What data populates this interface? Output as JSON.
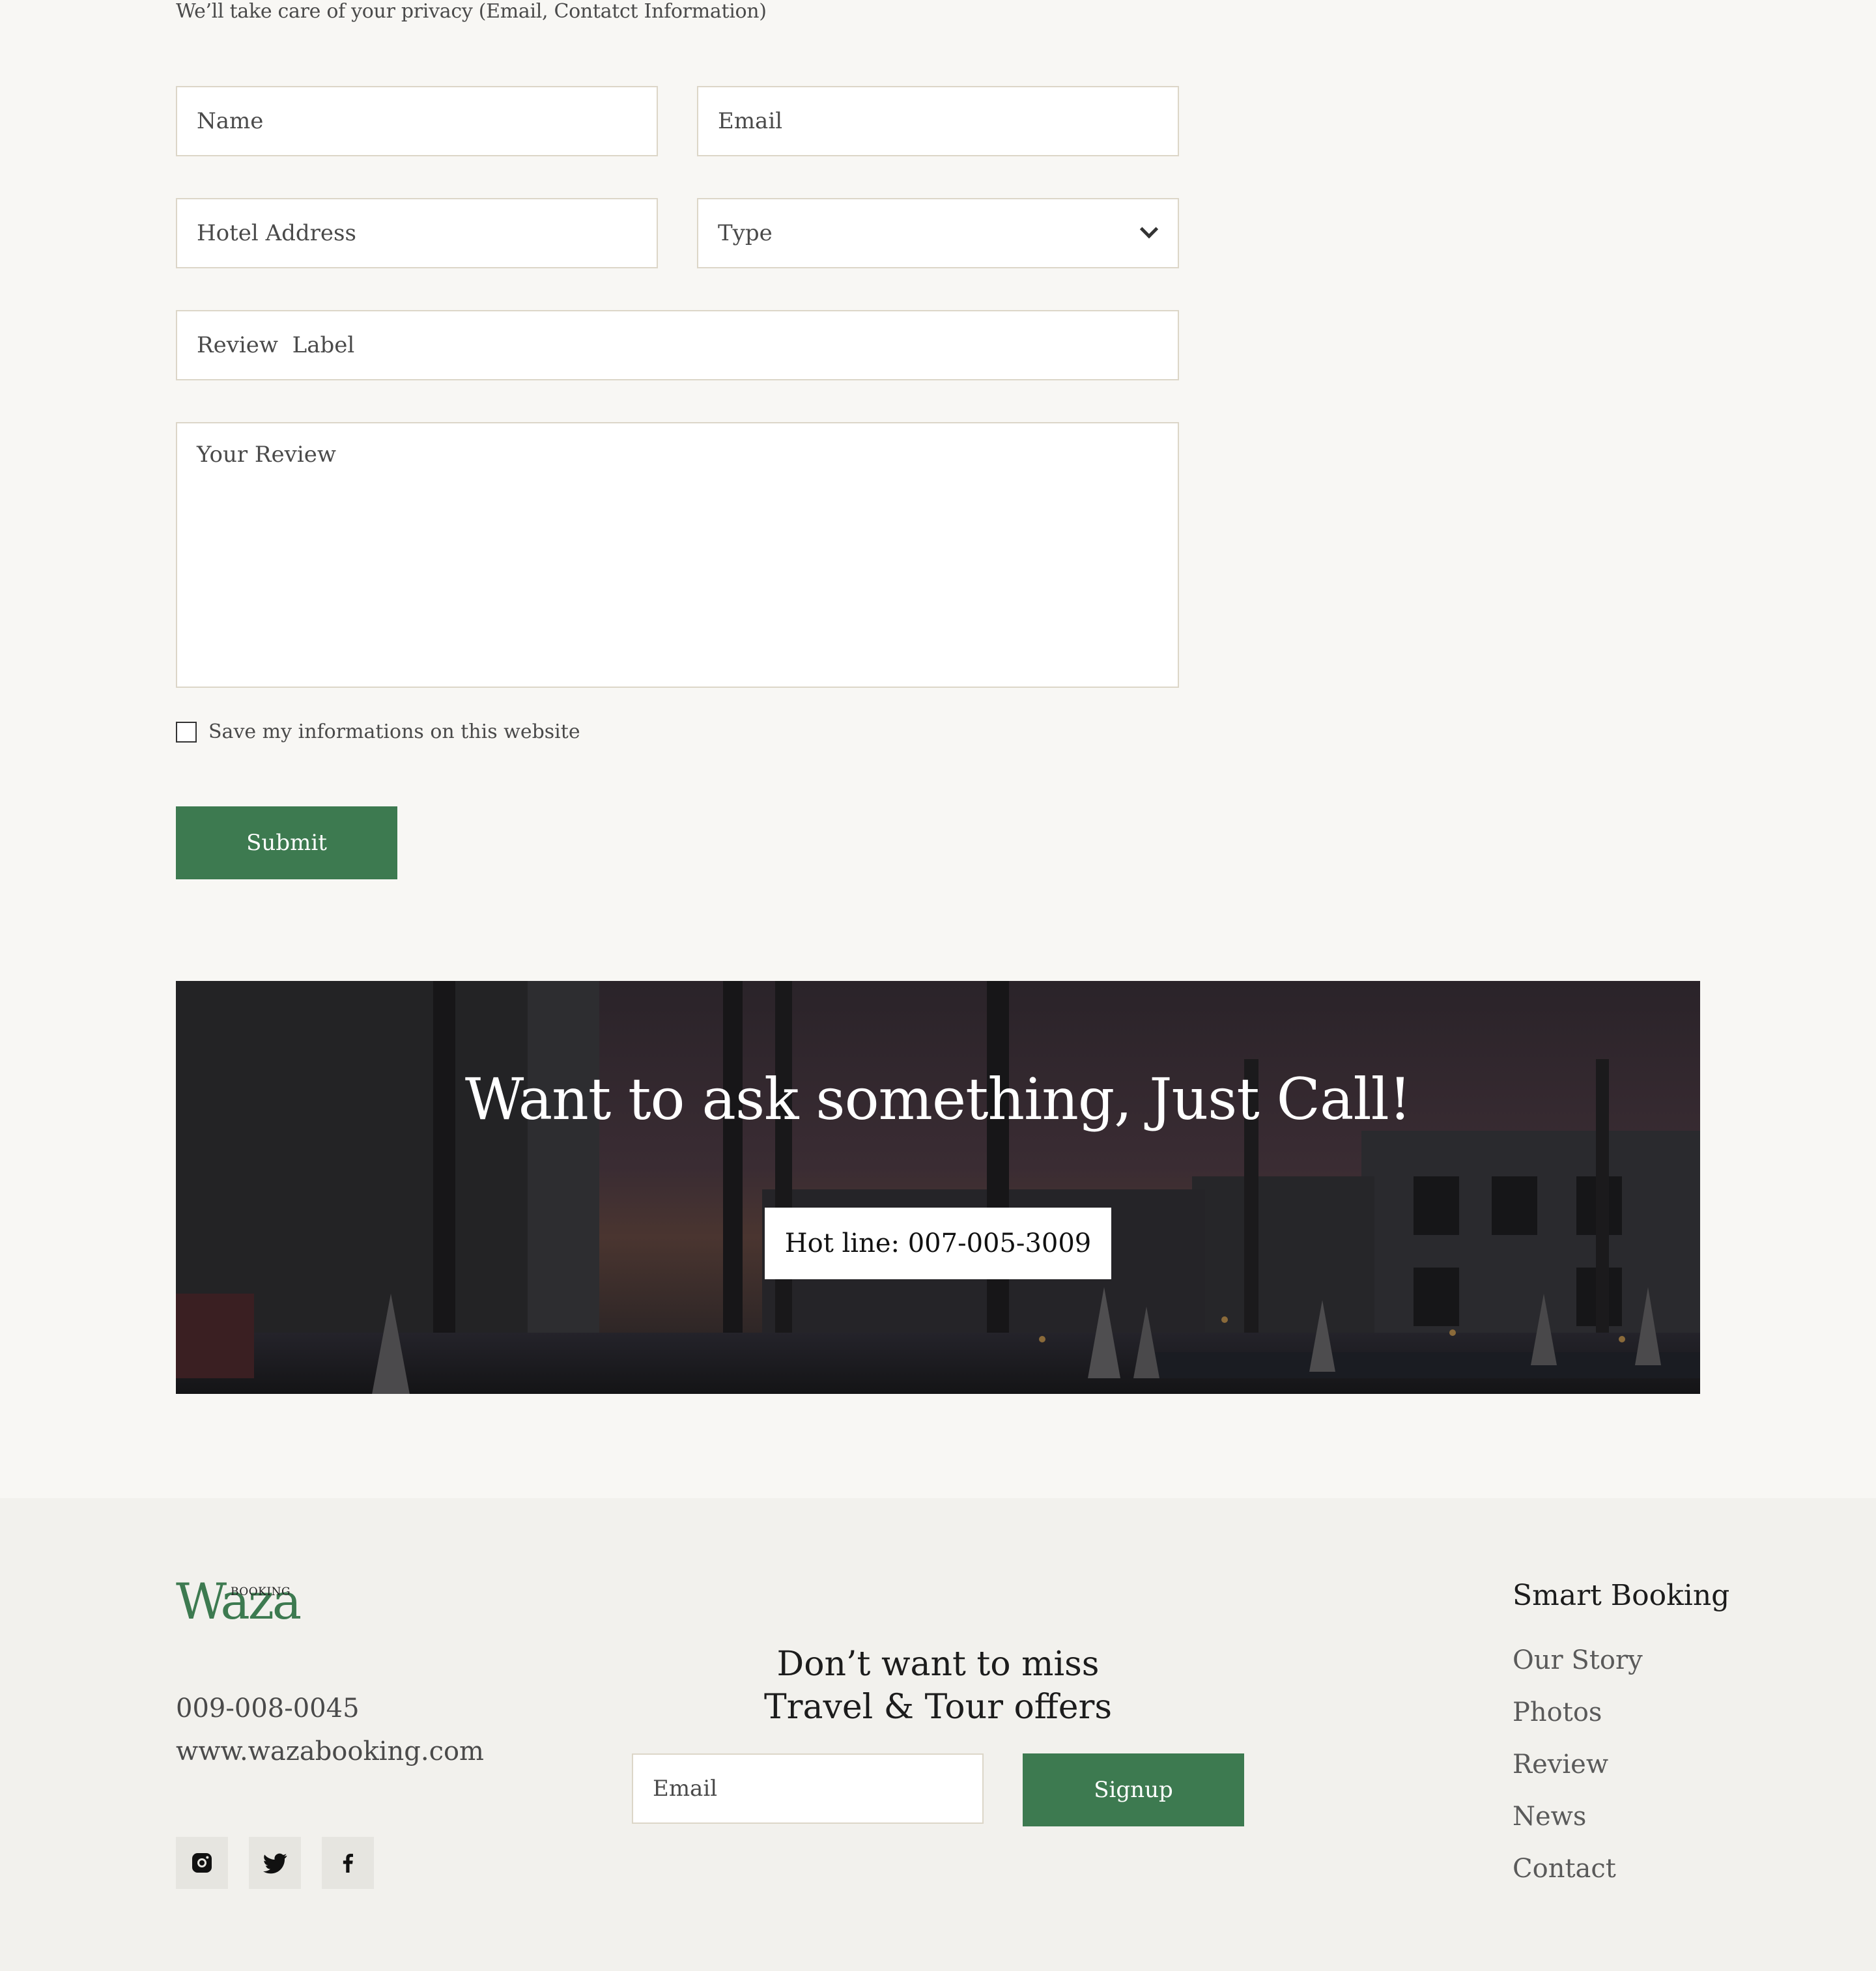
{
  "form": {
    "privacy_note": "We’ll take care of your privacy (Email, Contatct Information)",
    "name_placeholder": "Name",
    "email_placeholder": "Email",
    "address_placeholder": "Hotel Address",
    "type_value": "Type",
    "review_label_placeholder": "Review  Label",
    "review_placeholder": "Your Review",
    "save_label": "Save my informations on this website",
    "save_checked": false,
    "submit_label": "Submit"
  },
  "banner": {
    "title": "Want to ask something, Just Call!",
    "hotline": "Hot line: 007-005-3009"
  },
  "footer": {
    "logo_text": "Waza",
    "logo_sub": "BOOKING",
    "phone": "009-008-0045",
    "website": "www.wazabooking.com",
    "social_icons": [
      "instagram-icon",
      "twitter-icon",
      "facebook-icon"
    ],
    "newsletter_line1": "Don’t want to miss",
    "newsletter_line2": "Travel & Tour offers",
    "newsletter_email_placeholder": "Email",
    "signup_label": "Signup",
    "links_title": "Smart Booking",
    "links": [
      "Our Story",
      "Photos",
      "Review",
      "News",
      "Contact"
    ]
  },
  "colors": {
    "accent": "#3d7a50",
    "page_background": "#f8f7f4",
    "footer_background": "#f2f1ed",
    "field_border": "#dcd6c8"
  }
}
